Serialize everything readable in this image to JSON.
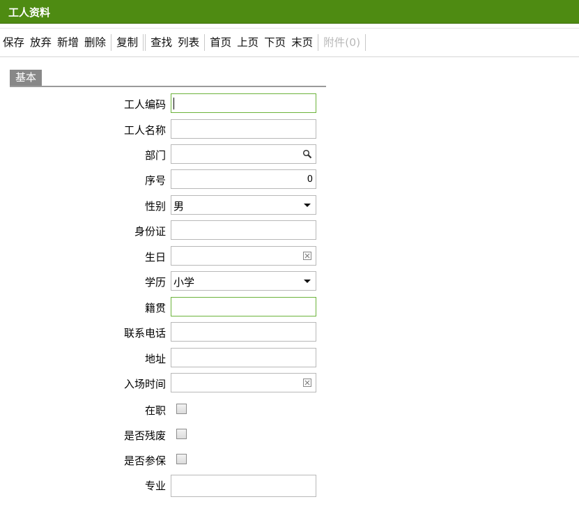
{
  "window": {
    "title": "工人资料"
  },
  "toolbar": {
    "save": "保存",
    "discard": "放弃",
    "add": "新增",
    "delete": "删除",
    "copy": "复制",
    "find": "查找",
    "list": "列表",
    "first": "首页",
    "prev": "上页",
    "next": "下页",
    "last": "末页",
    "attachment": "附件(0)"
  },
  "section": {
    "basic": "基本"
  },
  "form": {
    "worker_code": {
      "label": "工人编码",
      "value": ""
    },
    "worker_name": {
      "label": "工人名称",
      "value": ""
    },
    "department": {
      "label": "部门",
      "value": ""
    },
    "seq": {
      "label": "序号",
      "value": "0"
    },
    "gender": {
      "label": "性别",
      "value": "男"
    },
    "id_card": {
      "label": "身份证",
      "value": ""
    },
    "birthday": {
      "label": "生日",
      "value": ""
    },
    "education": {
      "label": "学历",
      "value": "小学"
    },
    "native_place": {
      "label": "籍贯",
      "value": ""
    },
    "phone": {
      "label": "联系电话",
      "value": ""
    },
    "address": {
      "label": "地址",
      "value": ""
    },
    "entry_date": {
      "label": "入场时间",
      "value": ""
    },
    "employed": {
      "label": "在职",
      "checked": false
    },
    "disabled": {
      "label": "是否残废",
      "checked": false
    },
    "insured": {
      "label": "是否参保",
      "checked": false
    },
    "major": {
      "label": "专业",
      "value": ""
    }
  },
  "colors": {
    "title_bar": "#4e8b12",
    "active_border": "#6bb33a",
    "section_tab": "#888888"
  },
  "icons": {
    "department_lookup": "search-icon",
    "date_picker": "calendar-icon",
    "select_arrow": "triangle-down-icon"
  }
}
